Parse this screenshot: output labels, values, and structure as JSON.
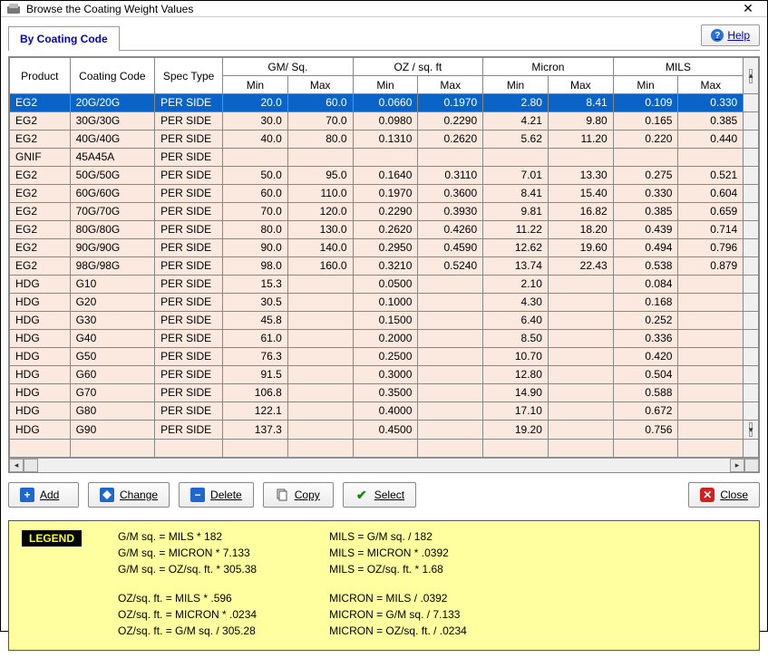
{
  "window": {
    "title": "Browse the Coating Weight Values"
  },
  "tabs": {
    "active": "By Coating Code"
  },
  "help": {
    "label": "Help"
  },
  "columns": {
    "product": "Product",
    "coating_code": "Coating Code",
    "spec_type": "Spec Type",
    "groups": [
      "GM/ Sq.",
      "OZ / sq. ft",
      "Micron",
      "MILS"
    ],
    "min": "Min",
    "max": "Max"
  },
  "rows": [
    {
      "product": "EG2",
      "code": "20G/20G",
      "spec": "PER SIDE",
      "gm_min": "20.0",
      "gm_max": "60.0",
      "oz_min": "0.0660",
      "oz_max": "0.1970",
      "mi_min": "2.80",
      "mi_max": "8.41",
      "ml_min": "0.109",
      "ml_max": "0.330",
      "selected": true
    },
    {
      "product": "EG2",
      "code": "30G/30G",
      "spec": "PER SIDE",
      "gm_min": "30.0",
      "gm_max": "70.0",
      "oz_min": "0.0980",
      "oz_max": "0.2290",
      "mi_min": "4.21",
      "mi_max": "9.80",
      "ml_min": "0.165",
      "ml_max": "0.385"
    },
    {
      "product": "EG2",
      "code": "40G/40G",
      "spec": "PER SIDE",
      "gm_min": "40.0",
      "gm_max": "80.0",
      "oz_min": "0.1310",
      "oz_max": "0.2620",
      "mi_min": "5.62",
      "mi_max": "11.20",
      "ml_min": "0.220",
      "ml_max": "0.440"
    },
    {
      "product": "GNIF",
      "code": "45A45A",
      "spec": "PER SIDE",
      "gm_min": "",
      "gm_max": "",
      "oz_min": "",
      "oz_max": "",
      "mi_min": "",
      "mi_max": "",
      "ml_min": "",
      "ml_max": ""
    },
    {
      "product": "EG2",
      "code": "50G/50G",
      "spec": "PER SIDE",
      "gm_min": "50.0",
      "gm_max": "95.0",
      "oz_min": "0.1640",
      "oz_max": "0.3110",
      "mi_min": "7.01",
      "mi_max": "13.30",
      "ml_min": "0.275",
      "ml_max": "0.521"
    },
    {
      "product": "EG2",
      "code": "60G/60G",
      "spec": "PER SIDE",
      "gm_min": "60.0",
      "gm_max": "110.0",
      "oz_min": "0.1970",
      "oz_max": "0.3600",
      "mi_min": "8.41",
      "mi_max": "15.40",
      "ml_min": "0.330",
      "ml_max": "0.604"
    },
    {
      "product": "EG2",
      "code": "70G/70G",
      "spec": "PER SIDE",
      "gm_min": "70.0",
      "gm_max": "120.0",
      "oz_min": "0.2290",
      "oz_max": "0.3930",
      "mi_min": "9.81",
      "mi_max": "16.82",
      "ml_min": "0.385",
      "ml_max": "0.659"
    },
    {
      "product": "EG2",
      "code": "80G/80G",
      "spec": "PER SIDE",
      "gm_min": "80.0",
      "gm_max": "130.0",
      "oz_min": "0.2620",
      "oz_max": "0.4260",
      "mi_min": "11.22",
      "mi_max": "18.20",
      "ml_min": "0.439",
      "ml_max": "0.714"
    },
    {
      "product": "EG2",
      "code": "90G/90G",
      "spec": "PER SIDE",
      "gm_min": "90.0",
      "gm_max": "140.0",
      "oz_min": "0.2950",
      "oz_max": "0.4590",
      "mi_min": "12.62",
      "mi_max": "19.60",
      "ml_min": "0.494",
      "ml_max": "0.796"
    },
    {
      "product": "EG2",
      "code": "98G/98G",
      "spec": "PER SIDE",
      "gm_min": "98.0",
      "gm_max": "160.0",
      "oz_min": "0.3210",
      "oz_max": "0.5240",
      "mi_min": "13.74",
      "mi_max": "22.43",
      "ml_min": "0.538",
      "ml_max": "0.879"
    },
    {
      "product": "HDG",
      "code": "G10",
      "spec": "PER SIDE",
      "gm_min": "15.3",
      "gm_max": "",
      "oz_min": "0.0500",
      "oz_max": "",
      "mi_min": "2.10",
      "mi_max": "",
      "ml_min": "0.084",
      "ml_max": ""
    },
    {
      "product": "HDG",
      "code": "G20",
      "spec": "PER SIDE",
      "gm_min": "30.5",
      "gm_max": "",
      "oz_min": "0.1000",
      "oz_max": "",
      "mi_min": "4.30",
      "mi_max": "",
      "ml_min": "0.168",
      "ml_max": ""
    },
    {
      "product": "HDG",
      "code": "G30",
      "spec": "PER SIDE",
      "gm_min": "45.8",
      "gm_max": "",
      "oz_min": "0.1500",
      "oz_max": "",
      "mi_min": "6.40",
      "mi_max": "",
      "ml_min": "0.252",
      "ml_max": ""
    },
    {
      "product": "HDG",
      "code": "G40",
      "spec": "PER SIDE",
      "gm_min": "61.0",
      "gm_max": "",
      "oz_min": "0.2000",
      "oz_max": "",
      "mi_min": "8.50",
      "mi_max": "",
      "ml_min": "0.336",
      "ml_max": ""
    },
    {
      "product": "HDG",
      "code": "G50",
      "spec": "PER SIDE",
      "gm_min": "76.3",
      "gm_max": "",
      "oz_min": "0.2500",
      "oz_max": "",
      "mi_min": "10.70",
      "mi_max": "",
      "ml_min": "0.420",
      "ml_max": ""
    },
    {
      "product": "HDG",
      "code": "G60",
      "spec": "PER SIDE",
      "gm_min": "91.5",
      "gm_max": "",
      "oz_min": "0.3000",
      "oz_max": "",
      "mi_min": "12.80",
      "mi_max": "",
      "ml_min": "0.504",
      "ml_max": ""
    },
    {
      "product": "HDG",
      "code": "G70",
      "spec": "PER SIDE",
      "gm_min": "106.8",
      "gm_max": "",
      "oz_min": "0.3500",
      "oz_max": "",
      "mi_min": "14.90",
      "mi_max": "",
      "ml_min": "0.588",
      "ml_max": ""
    },
    {
      "product": "HDG",
      "code": "G80",
      "spec": "PER SIDE",
      "gm_min": "122.1",
      "gm_max": "",
      "oz_min": "0.4000",
      "oz_max": "",
      "mi_min": "17.10",
      "mi_max": "",
      "ml_min": "0.672",
      "ml_max": ""
    },
    {
      "product": "HDG",
      "code": "G90",
      "spec": "PER SIDE",
      "gm_min": "137.3",
      "gm_max": "",
      "oz_min": "0.4500",
      "oz_max": "",
      "mi_min": "19.20",
      "mi_max": "",
      "ml_min": "0.756",
      "ml_max": ""
    }
  ],
  "buttons": {
    "add": "Add",
    "change": "Change",
    "delete": "Delete",
    "copy": "Copy",
    "select": "Select",
    "close": "Close"
  },
  "legend": {
    "title": "LEGEND",
    "left": [
      "G/M sq. = MILS * 182",
      "G/M sq. = MICRON * 7.133",
      "G/M sq. = OZ/sq. ft.  * 305.38",
      "",
      "OZ/sq. ft. = MILS * .596",
      "OZ/sq. ft. = MICRON * .0234",
      "OZ/sq. ft. = G/M sq.  / 305.28"
    ],
    "right": [
      "MILS = G/M sq. / 182",
      "MILS = MICRON * .0392",
      "MILS = OZ/sq. ft. * 1.68",
      "",
      "MICRON = MILS / .0392",
      "MICRON = G/M sq. / 7.133",
      "MICRON = OZ/sq. ft. / .0234"
    ]
  }
}
